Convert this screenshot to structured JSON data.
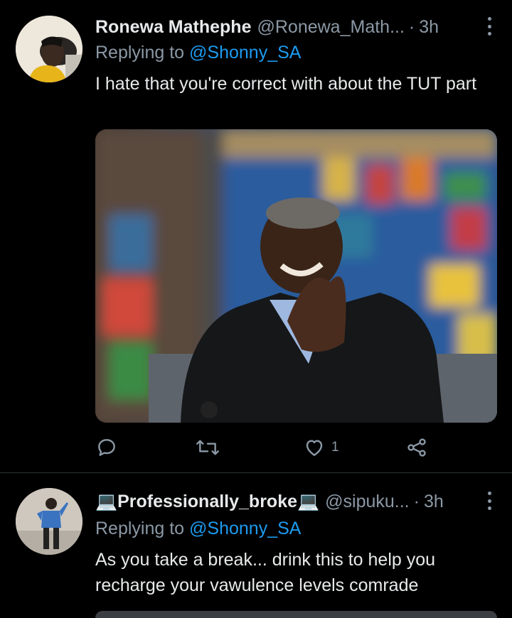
{
  "tweets": [
    {
      "author_name": "Ronewa Mathephe",
      "author_handle": "@Ronewa_Math...",
      "separator": "·",
      "time": "3h",
      "replying_prefix": "Replying to",
      "replying_to": "@Shonny_SA",
      "text": "I hate that you're correct with about the TUT part",
      "likes": "1"
    },
    {
      "author_name": "💻Professionally_broke💻",
      "author_handle": "@sipuku...",
      "separator": "·",
      "time": "3h",
      "replying_prefix": "Replying to",
      "replying_to": "@Shonny_SA",
      "text": "As you take a break... drink this to help you recharge your vawulence levels comrade"
    }
  ],
  "icons": {
    "reply": "reply-icon",
    "retweet": "retweet-icon",
    "like": "heart-icon",
    "share": "share-icon",
    "more": "more-icon"
  },
  "colors": {
    "background": "#000000",
    "text": "#e7e9ea",
    "secondary": "#8b98a5",
    "link": "#1d9bf0",
    "divider": "#2f3336"
  }
}
